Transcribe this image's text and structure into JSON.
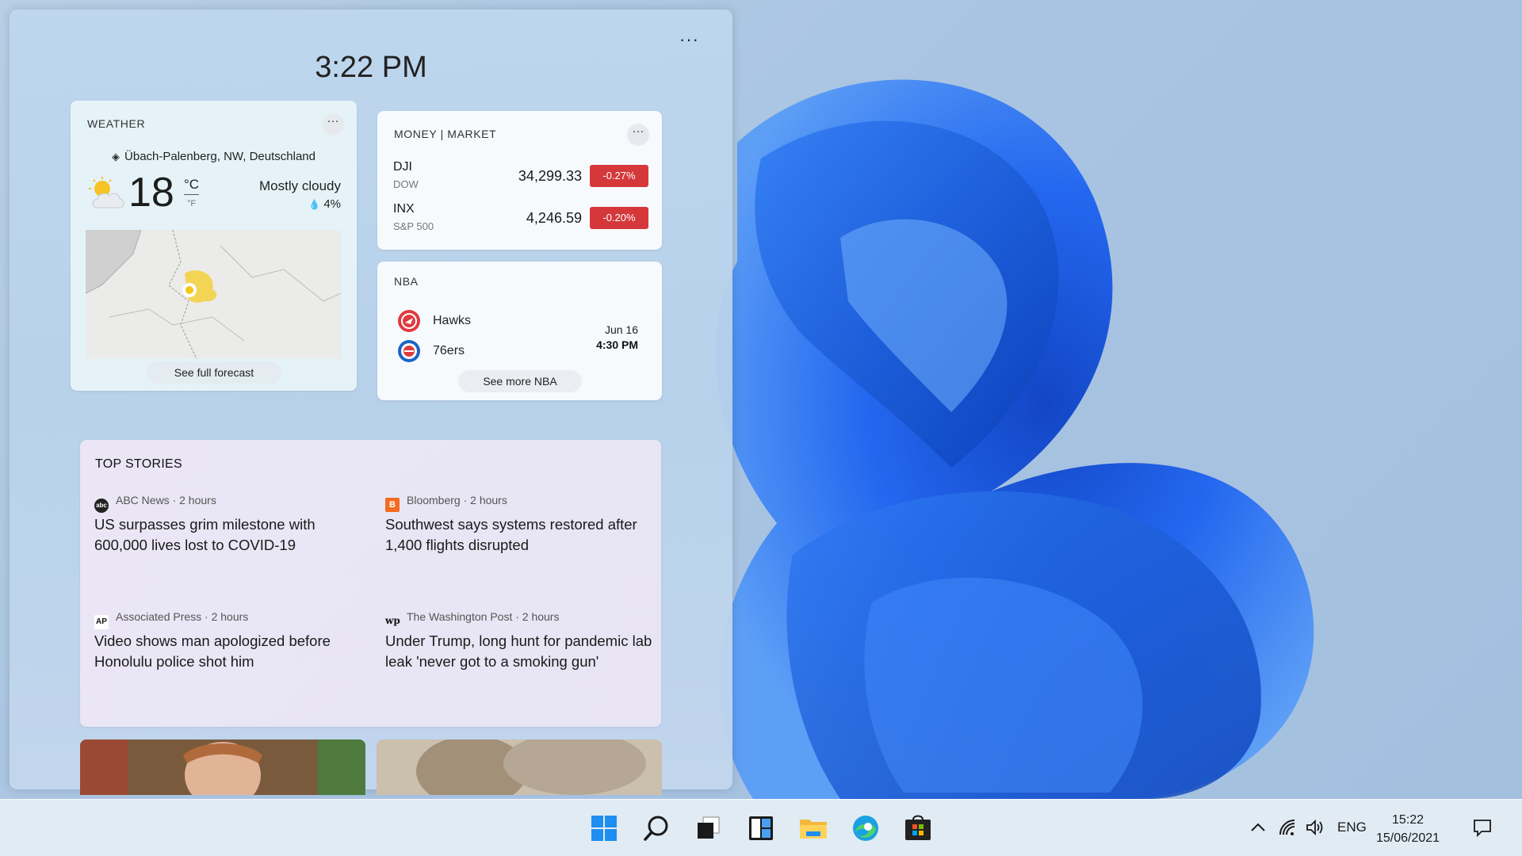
{
  "panel": {
    "time": "3:22 PM",
    "more_label": "···"
  },
  "weather": {
    "title": "WEATHER",
    "more_label": "···",
    "location": "Übach-Palenberg, NW, Deutschland",
    "temperature": "18",
    "unit_c": "°C",
    "unit_f": "°F",
    "condition": "Mostly cloudy",
    "precipitation": "4%",
    "forecast_link": "See full forecast"
  },
  "market": {
    "title": "MONEY | MARKET",
    "more_label": "···",
    "stocks": [
      {
        "symbol": "DJI",
        "name": "DOW",
        "price": "34,299.33",
        "change": "-0.27%"
      },
      {
        "symbol": "INX",
        "name": "S&P 500",
        "price": "4,246.59",
        "change": "-0.20%"
      }
    ],
    "negative_color": "#d5383b"
  },
  "nba": {
    "title": "NBA",
    "teams": [
      {
        "name": "Hawks"
      },
      {
        "name": "76ers"
      }
    ],
    "date": "Jun 16",
    "time": "4:30 PM",
    "more_link": "See more NBA"
  },
  "stories": {
    "title": "TOP STORIES",
    "items": [
      {
        "source": "ABC News · 2 hours",
        "headline": "US surpasses grim milestone with 600,000 lives lost to COVID-19"
      },
      {
        "source": "Bloomberg · 2 hours",
        "headline": "Southwest says systems restored after 1,400 flights disrupted"
      },
      {
        "source": "Associated Press · 2 hours",
        "headline": "Video shows man apologized before Honolulu police shot him"
      },
      {
        "source": "The Washington Post · 2 hours",
        "headline": "Under Trump, long hunt for pandemic lab leak 'never got to a smoking gun'"
      }
    ]
  },
  "taskbar": {
    "icons": [
      "start-icon",
      "search-icon",
      "task-view-icon",
      "widgets-icon",
      "file-explorer-icon",
      "edge-icon",
      "store-icon"
    ],
    "language": "ENG",
    "time": "15:22",
    "date": "15/06/2021"
  },
  "colors": {
    "accent": "#0a5ce6",
    "wallpaper_blue": "#1b5fe8"
  }
}
